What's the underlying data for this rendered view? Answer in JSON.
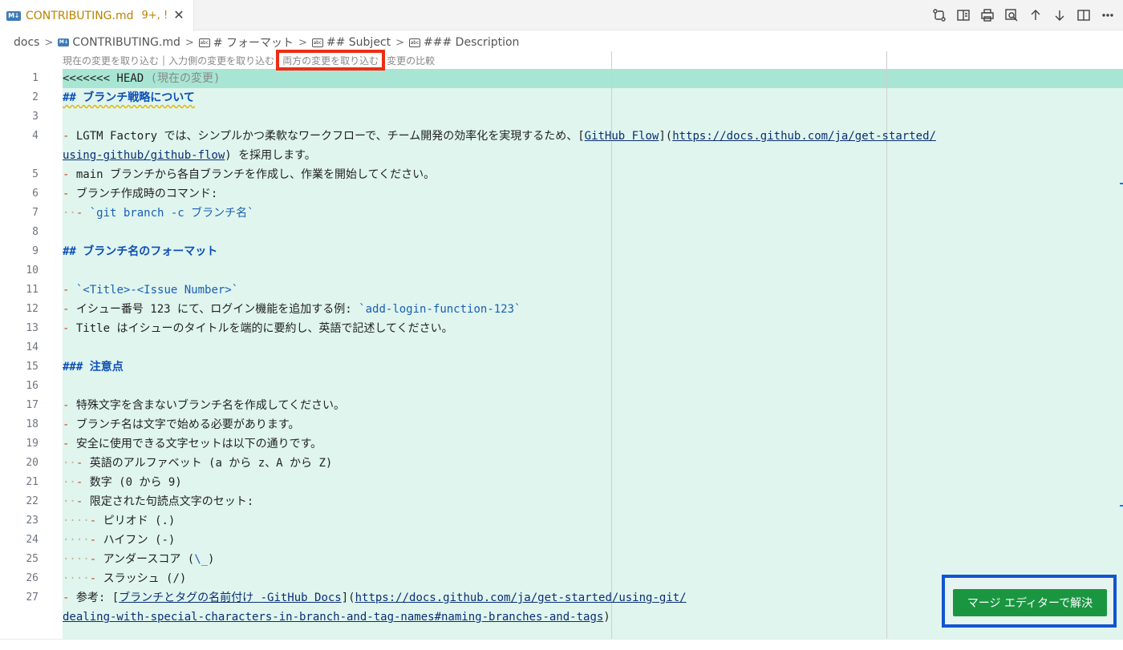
{
  "tab": {
    "icon": "markdown-icon",
    "name": "CONTRIBUTING.md",
    "badge": "9+, !",
    "close": "✕"
  },
  "toolbar": {
    "icons": [
      "compare-changes-icon",
      "open-preview-icon",
      "print-icon",
      "search-preview-icon",
      "previous-conflict-icon",
      "next-conflict-icon",
      "split-editor-icon",
      "more-actions-icon"
    ]
  },
  "breadcrumb": {
    "folder": "docs",
    "file": "CONTRIBUTING.md",
    "s1": "# フォーマット",
    "s2": "## Subject",
    "s3": "### Description"
  },
  "codelens": {
    "accept_current": "現在の変更を取り込む",
    "accept_incoming": "入力側の変更を取り込む",
    "accept_both": "両方の変更を取り込む",
    "compare": "変更の比較"
  },
  "line_numbers": [
    "1",
    "2",
    "3",
    "4",
    "5",
    "6",
    "7",
    "8",
    "9",
    "10",
    "11",
    "12",
    "13",
    "14",
    "15",
    "16",
    "17",
    "18",
    "19",
    "20",
    "21",
    "22",
    "23",
    "24",
    "25",
    "26",
    "27"
  ],
  "code": {
    "l1_marker": "<<<<<<< HEAD",
    "l1_label": "(現在の変更)",
    "l2": "## ブランチ戦略について",
    "l4_a": " LGTM Factory では、シンプルかつ柔軟なワークフローで、チーム開発の効率化を実現するため、[",
    "l4_link": "GitHub Flow",
    "l4_b": "](",
    "l4_url": "https://docs.github.com/ja/get-started/",
    "l4_url2": "using-github/github-flow",
    "l4_c": ") を採用します。",
    "l5": " main ブランチから各自ブランチを作成し、作業を開始してください。",
    "l6": " ブランチ作成時のコマンド:",
    "l7": "`git branch -c ブランチ名`",
    "l9": "## ブランチ名のフォーマット",
    "l11": "`<Title>-<Issue Number>`",
    "l12_a": " イシュー番号 123 にて、ログイン機能を追加する例: ",
    "l12_code": "`add-login-function-123`",
    "l13": " Title はイシューのタイトルを端的に要約し、英語で記述してください。",
    "l15": "### 注意点",
    "l17": " 特殊文字を含まないブランチ名を作成してください。",
    "l18": " ブランチ名は文字で始める必要があります。",
    "l19": " 安全に使用できる文字セットは以下の通りです。",
    "l20": " 英語のアルファベット (a から z、A から Z)",
    "l21": " 数字 (0 から 9)",
    "l22": " 限定された句読点文字のセット:",
    "l23": " ピリオド (.)",
    "l24": " ハイフン (-)",
    "l25_a": " アンダースコア (",
    "l25_code": "\\_",
    "l25_b": ")",
    "l26": " スラッシュ (/)",
    "l27_a": " 参考: [",
    "l27_link": "ブランチとタグの名前付け -GitHub Docs",
    "l27_b": "](",
    "l27_url": "https://docs.github.com/ja/get-started/using-git/",
    "l27_url2": "dealing-with-special-characters-in-branch-and-tag-names#naming-branches-and-tags",
    "l27_c": ")",
    "dash": "-",
    "hash2": "##",
    "hash3": "###"
  },
  "merge": {
    "button_label": "マージ エディターで解決"
  },
  "colors": {
    "conflict_current_bg": "#dff5ee",
    "conflict_header_bg": "#a8e6d3",
    "merge_button": "#1a9641",
    "highlight_red": "#ee2d14",
    "highlight_blue": "#1155d0"
  }
}
